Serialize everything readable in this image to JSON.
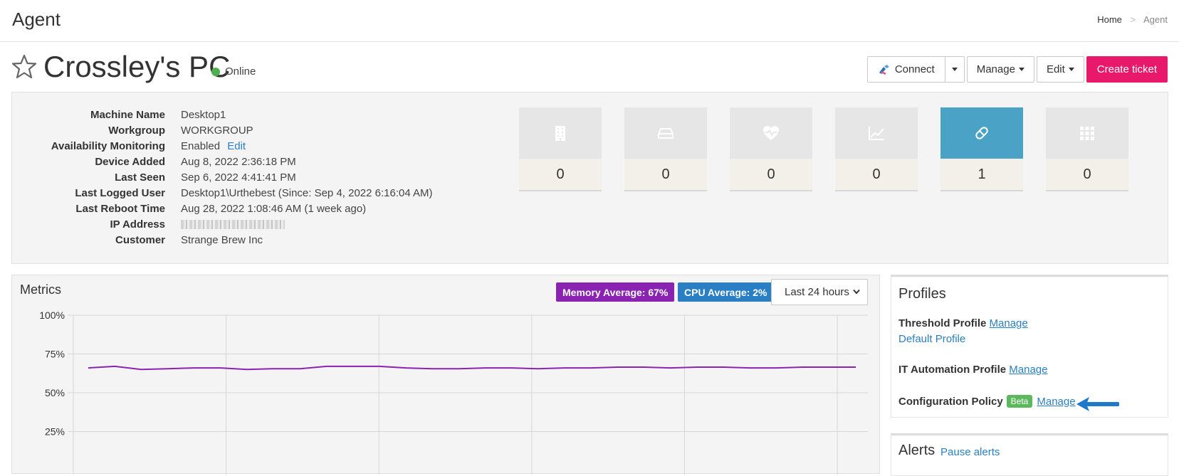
{
  "topbar": {
    "title": "Agent",
    "breadcrumb": {
      "home": "Home",
      "sep": ">",
      "current": "Agent"
    }
  },
  "header": {
    "name": "Crossley's PC",
    "status": "Online",
    "status_color": "#4cb050",
    "buttons": {
      "connect": "Connect",
      "manage": "Manage",
      "edit": "Edit",
      "create_ticket": "Create ticket"
    }
  },
  "info": [
    {
      "key": "Machine Name",
      "value": "Desktop1"
    },
    {
      "key": "Workgroup",
      "value": "WORKGROUP"
    },
    {
      "key": "Availability Monitoring",
      "value": "Enabled",
      "link": "Edit"
    },
    {
      "key": "Device Added",
      "value": "Aug 8, 2022 2:36:18 PM"
    },
    {
      "key": "Last Seen",
      "value": "Sep 6, 2022 4:41:41 PM"
    },
    {
      "key": "Last Logged User",
      "value": "Desktop1\\Urthebest (Since: Sep 4, 2022 6:16:04 AM)"
    },
    {
      "key": "Last Reboot Time",
      "value": "Aug 28, 2022 1:08:46 AM (1 week ago)"
    },
    {
      "key": "IP Address",
      "value": ""
    },
    {
      "key": "Customer",
      "value": "Strange Brew Inc",
      "is_link": true
    }
  ],
  "tiles": [
    {
      "icon": "building-icon",
      "count": "0"
    },
    {
      "icon": "drive-icon",
      "count": "0"
    },
    {
      "icon": "heartbeat-icon",
      "count": "0"
    },
    {
      "icon": "trend-chart-icon",
      "count": "0"
    },
    {
      "icon": "patch-icon",
      "count": "1",
      "active": true
    },
    {
      "icon": "grid-icon",
      "count": "0"
    }
  ],
  "metrics": {
    "title": "Metrics",
    "memory_badge": "Memory Average: 67%",
    "cpu_badge": "CPU Average: 2%",
    "range_select": "Last 24 hours",
    "memory_color": "#8a22b2",
    "cpu_color": "#2a7fc4"
  },
  "chart_data": {
    "type": "line",
    "ylim": [
      0,
      100
    ],
    "y_ticks": [
      "100%",
      "75%",
      "50%",
      "25%"
    ],
    "series": [
      {
        "name": "Memory",
        "color": "#8a22b2",
        "values": [
          66,
          67,
          65,
          65.5,
          66,
          66,
          65,
          65.5,
          65.5,
          67,
          67,
          67,
          66,
          65.5,
          65.5,
          66,
          66,
          65.5,
          66,
          66,
          66.5,
          66.5,
          66,
          66.5,
          66.5,
          66,
          66,
          66.5,
          66.5,
          66.5
        ]
      }
    ]
  },
  "profiles": {
    "title": "Profiles",
    "threshold_label": "Threshold Profile",
    "threshold_manage": "Manage",
    "threshold_value": "Default Profile",
    "it_label": "IT Automation Profile",
    "it_manage": "Manage",
    "config_label": "Configuration Policy",
    "config_badge": "Beta",
    "config_manage": "Manage"
  },
  "alerts": {
    "title": "Alerts",
    "pause": "Pause alerts"
  }
}
